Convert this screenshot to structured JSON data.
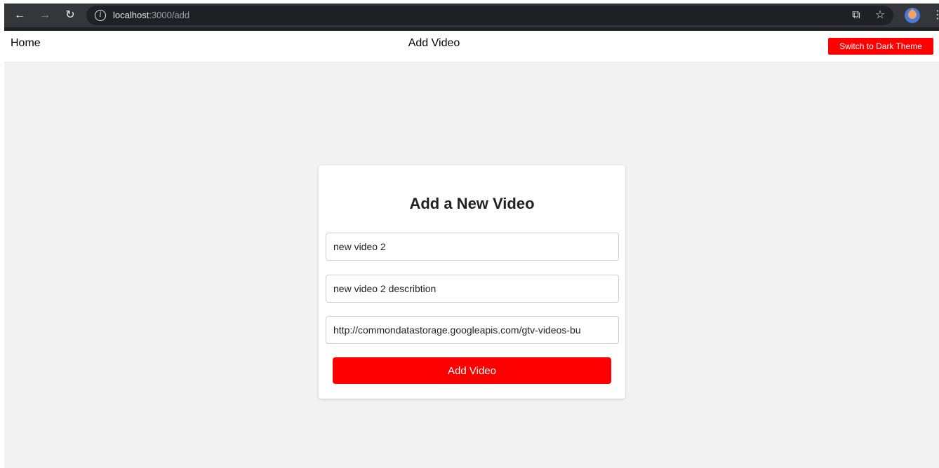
{
  "browser": {
    "url_host": "localhost",
    "url_path": ":3000/add",
    "back_icon": "arrow-left",
    "forward_icon": "arrow-right",
    "reload_icon": "reload",
    "info_icon": "info",
    "cast_icon": "cast",
    "star_icon": "star",
    "menu_icon": "kebab"
  },
  "header": {
    "home_label": "Home",
    "title": "Add Video",
    "theme_button_label": "Switch to Dark Theme",
    "accent_color": "#ff0000"
  },
  "form": {
    "heading": "Add a New Video",
    "title_value": "new video 2",
    "description_value": "new video 2 describtion",
    "url_value": "http://commondatastorage.googleapis.com/gtv-videos-bu",
    "submit_label": "Add Video"
  }
}
